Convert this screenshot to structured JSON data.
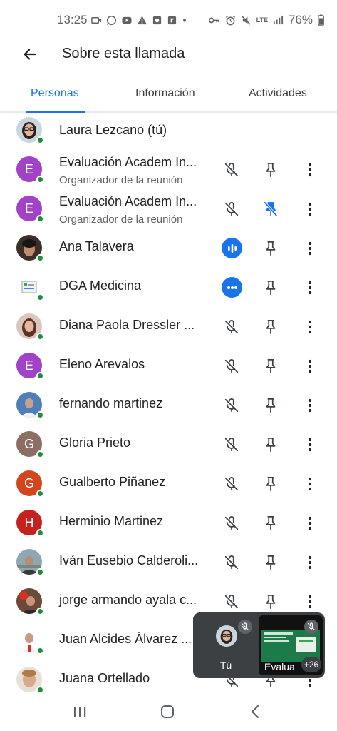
{
  "status_bar": {
    "time": "13:25",
    "network": "LTE",
    "battery": "76%"
  },
  "header": {
    "title": "Sobre esta llamada",
    "back_icon": "arrow-back-icon"
  },
  "tabs": [
    {
      "label": "Personas",
      "active": true
    },
    {
      "label": "Información",
      "active": false
    },
    {
      "label": "Actividades",
      "active": false
    }
  ],
  "participants": [
    {
      "name": "Laura Lezcano (tú)",
      "avatar": "photo",
      "status": "self"
    },
    {
      "name": "Evaluación Academ In...",
      "subtitle": "Organizador de la reunión",
      "avatar": "E",
      "avatar_color": "#a142c8",
      "status": "muted",
      "pinned": false
    },
    {
      "name": "Evaluación Academ In...",
      "subtitle": "Organizador de la reunión",
      "avatar": "E",
      "avatar_color": "#a142c8",
      "status": "muted",
      "pinned": true
    },
    {
      "name": "Ana Talavera",
      "avatar": "photo",
      "status": "speaking",
      "pinned": false
    },
    {
      "name": "DGA Medicina",
      "avatar": "photo",
      "status": "speaking-dots",
      "pinned": false
    },
    {
      "name": "Diana Paola Dressler ...",
      "avatar": "photo",
      "status": "muted",
      "pinned": false
    },
    {
      "name": "Eleno Arevalos",
      "avatar": "E",
      "avatar_color": "#a142c8",
      "status": "muted",
      "pinned": false
    },
    {
      "name": "fernando martinez",
      "avatar": "photo",
      "status": "muted",
      "pinned": false
    },
    {
      "name": "Gloria Prieto",
      "avatar": "G",
      "avatar_color": "#8d6e63",
      "status": "muted",
      "pinned": false
    },
    {
      "name": "Gualberto Piñanez",
      "avatar": "G",
      "avatar_color": "#d2461e",
      "status": "muted",
      "pinned": false
    },
    {
      "name": "Herminio Martinez",
      "avatar": "H",
      "avatar_color": "#c5221f",
      "status": "muted",
      "pinned": false
    },
    {
      "name": "Iván Eusebio Calderoli...",
      "avatar": "photo",
      "status": "muted",
      "pinned": false
    },
    {
      "name": "jorge armando ayala c...",
      "avatar": "photo",
      "status": "muted",
      "pinned": false
    },
    {
      "name": "Juan Alcides Álvarez ...",
      "avatar": "photo",
      "status": "muted",
      "pinned": false
    },
    {
      "name": "Juana Ortellado",
      "avatar": "photo",
      "status": "muted",
      "pinned": false
    }
  ],
  "pip": {
    "self_label": "Tú",
    "other_label": "Evalua",
    "extra_count": "+26"
  },
  "colors": {
    "accent": "#1a73e8",
    "online": "#1e8e3e"
  }
}
